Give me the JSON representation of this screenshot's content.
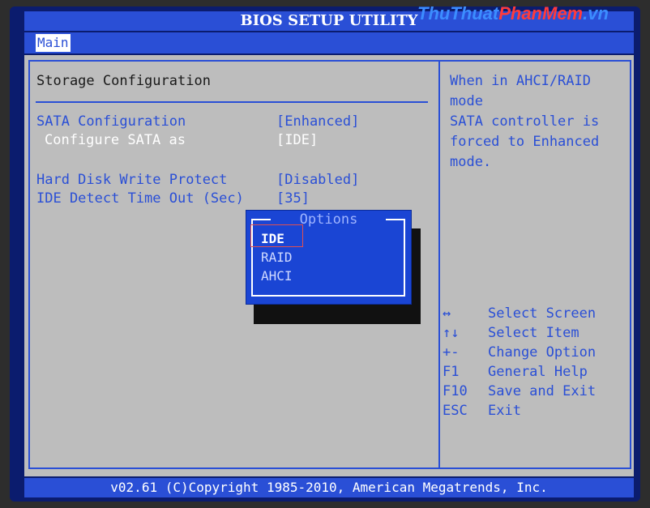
{
  "window": {
    "title": "BIOS SETUP UTILITY"
  },
  "watermark": {
    "part1": "ThuThuat",
    "part2": "PhanMem",
    "part3": ".vn"
  },
  "menu": {
    "active_tab": "Main"
  },
  "main": {
    "section_title": "Storage Configuration",
    "settings": [
      {
        "label": "SATA Configuration",
        "value": "[Enhanced]",
        "selected": false
      },
      {
        "label": "Configure SATA as",
        "value": "[IDE]",
        "selected": true
      },
      {
        "label": "Hard Disk Write Protect",
        "value": "[Disabled]",
        "selected": false
      },
      {
        "label": "IDE Detect Time Out (Sec)",
        "value": "[35]",
        "selected": false
      }
    ]
  },
  "help": {
    "text": "When in AHCI/RAID mode\nSATA controller is\nforced to Enhanced\nmode."
  },
  "keys": [
    {
      "key": "↔",
      "action": "Select Screen"
    },
    {
      "key": "↑↓",
      "action": "Select Item"
    },
    {
      "key": "+-",
      "action": "Change Option"
    },
    {
      "key": "F1",
      "action": "General Help"
    },
    {
      "key": "F10",
      "action": "Save and Exit"
    },
    {
      "key": "ESC",
      "action": "Exit"
    }
  ],
  "popup": {
    "title": "Options",
    "options": [
      "IDE",
      "RAID",
      "AHCI"
    ],
    "selected_index": 0
  },
  "status": {
    "text": "v02.61 (C)Copyright 1985-2010, American Megatrends, Inc."
  },
  "colors": {
    "bios_blue": "#2a4fd6",
    "panel_gray": "#bdbdbd",
    "popup_blue": "#1a45d4"
  }
}
